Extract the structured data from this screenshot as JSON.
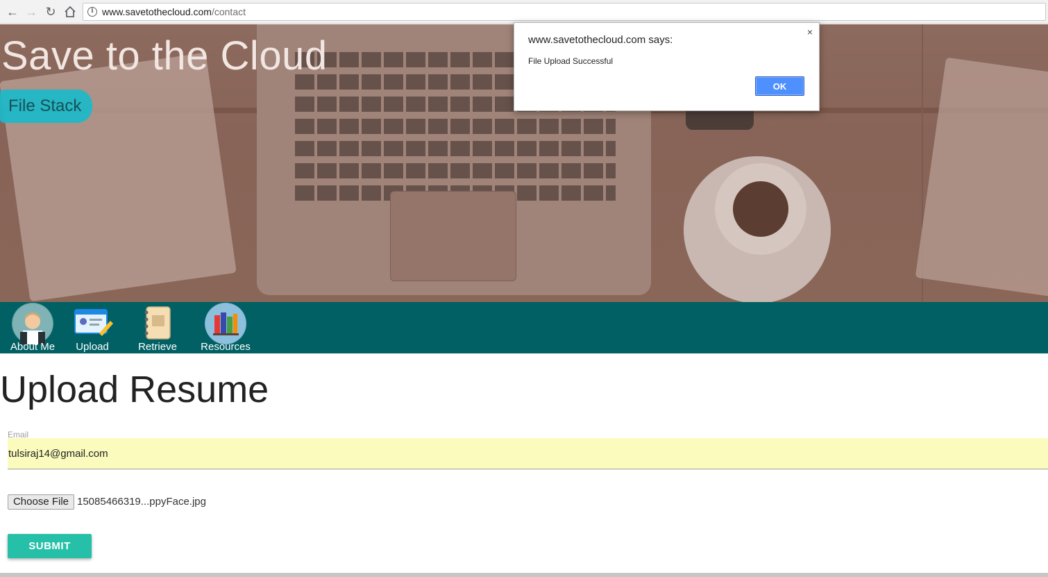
{
  "browser": {
    "url_host": "www.savetothecloud.com",
    "url_path": "/contact",
    "back_icon": "arrow-left",
    "forward_icon": "arrow-right",
    "reload_icon": "reload",
    "home_icon": "home",
    "info_icon": "info"
  },
  "hero": {
    "title": "Save to the Cloud",
    "button_label": "File Stack"
  },
  "nav": {
    "items": [
      {
        "label": "About Me",
        "icon": "person-avatar-icon"
      },
      {
        "label": "Upload",
        "icon": "id-card-icon"
      },
      {
        "label": "Retrieve",
        "icon": "notebook-icon"
      },
      {
        "label": "Resources",
        "icon": "books-icon"
      }
    ]
  },
  "form": {
    "title": "Upload Resume",
    "email_label": "Email",
    "email_value": "tulsiraj14@gmail.com",
    "file_button": "Choose File",
    "file_name": "15085466319...ppyFace.jpg",
    "submit_label": "SUBMIT"
  },
  "dialog": {
    "heading": "www.savetothecloud.com says:",
    "message": "File Upload Successful",
    "ok_label": "OK",
    "close_glyph": "×"
  },
  "colors": {
    "nav_bg": "#006064",
    "accent": "#26bfa8",
    "file_stack_bg": "#1fb8c8",
    "input_bg": "#fafbbd",
    "dialog_ok": "#4d90fe"
  }
}
